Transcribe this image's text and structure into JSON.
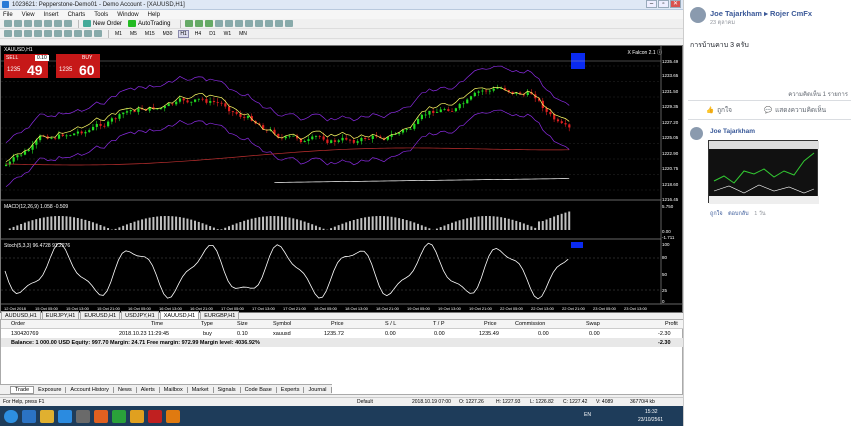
{
  "window": {
    "title": "1023621: Pepperstone-Demo01 - Demo Account - [XAUUSD,H1]",
    "controls": [
      "–",
      "▫",
      "✕"
    ]
  },
  "menu": [
    "File",
    "View",
    "Insert",
    "Charts",
    "Tools",
    "Window",
    "Help"
  ],
  "toolbar": {
    "new_order": "New Order",
    "autotrading": "AutoTrading",
    "timeframes": [
      "M1",
      "M5",
      "M15",
      "M30",
      "H1",
      "H4",
      "D1",
      "W1",
      "MN"
    ],
    "active_tf": "H1"
  },
  "chart": {
    "tab_label": "XAUUSD,H1",
    "symbol_label": "X Falcon 2.1 ⓘ",
    "panel": {
      "sell": "SELL",
      "buy": "BUY",
      "lot": "0.10",
      "sell_prefix": "1235",
      "sell_big": "49",
      "buy_prefix": "1235",
      "buy_big": "60"
    },
    "macd_label": "MACD(12,26,9) 1.058 -0.509",
    "stoch_label": "Stoch(5,3,3) 96.4728 91.2276",
    "price_scale": [
      "1235.49",
      "1233.65",
      "1231.50",
      "1229.35",
      "1227.20",
      "1225.05",
      "1222.90",
      "1220.75",
      "1218.60",
      "1216.45"
    ],
    "macd_scale": [
      "5.750",
      "0.00",
      "-1.711"
    ],
    "stoch_scale": [
      "100",
      "80",
      "50",
      "25",
      "0"
    ],
    "time_scale": [
      "12 Oct 2018",
      "15 Oct 05:00",
      "15 Oct 13:00",
      "15 Oct 21:00",
      "16 Oct 05:00",
      "16 Oct 13:00",
      "16 Oct 21:00",
      "17 Oct 05:00",
      "17 Oct 13:00",
      "17 Oct 21:00",
      "18 Oct 05:00",
      "18 Oct 13:00",
      "18 Oct 21:00",
      "19 Oct 05:00",
      "19 Oct 13:00",
      "19 Oct 21:00",
      "22 Oct 05:00",
      "22 Oct 13:00",
      "22 Oct 21:00",
      "23 Oct 05:00",
      "23 Oct 13:00"
    ]
  },
  "symbol_tabs": [
    "AUDUSD,H1",
    "EURJPY,H1",
    "EURUSD,H1",
    "USDJPY,H1",
    "XAUUSD,H1",
    "EURGBP,H1"
  ],
  "active_symbol_tab": "XAUUSD,H1",
  "trade": {
    "headers": [
      "Order",
      "Time",
      "Type",
      "Size",
      "Symbol",
      "Price",
      "S / L",
      "T / P",
      "Price",
      "Commission",
      "Swap",
      "Profit"
    ],
    "row": [
      "130420769",
      "2018.10.23 11:29:45",
      "buy",
      "0.10",
      "xauusd",
      "1235.72",
      "0.00",
      "0.00",
      "1235.49",
      "0.00",
      "0.00",
      "-2.30"
    ],
    "balance": "Balance: 1 000.00 USD  Equity: 997.70  Margin: 24.71  Free margin: 972.99  Margin level: 4036.92%",
    "balance_profit": "-2.30"
  },
  "bottom_tabs": [
    "Trade",
    "Exposure",
    "Account History",
    "News",
    "Alerts",
    "Mailbox",
    "Market",
    "Signals",
    "Code Base",
    "Experts",
    "Journal"
  ],
  "status": {
    "help": "For Help, press F1",
    "profile": "Default",
    "time": "2018.10.19 07:00",
    "o": "O: 1227.26",
    "h": "H: 1227.93",
    "l": "L: 1226.82",
    "c": "C: 1227.42",
    "v": "V: 4089",
    "traffic": "36770/4 kb"
  },
  "tray": {
    "lang": "EN",
    "time": "15:32",
    "date": "23/10/2561"
  },
  "facebook": {
    "author": "Joe Tajarkham",
    "arrow": "▸",
    "group": "Rojer CmFx",
    "post_time": "23 ตุลาคม",
    "post_text": "การบ้านคาบ 3 ครับ",
    "comment_count": "ความคิดเห็น 1 รายการ",
    "like": "ถูกใจ",
    "comment": "แสดงความคิดเห็น",
    "commenter": "Joe Tajarkham",
    "c_like": "ถูกใจ",
    "c_reply": "ตอบกลับ",
    "c_time": "1 วัน"
  },
  "colors": {
    "sell": "#c61818",
    "chart_bg": "#000000",
    "fb_link": "#3b5998"
  }
}
